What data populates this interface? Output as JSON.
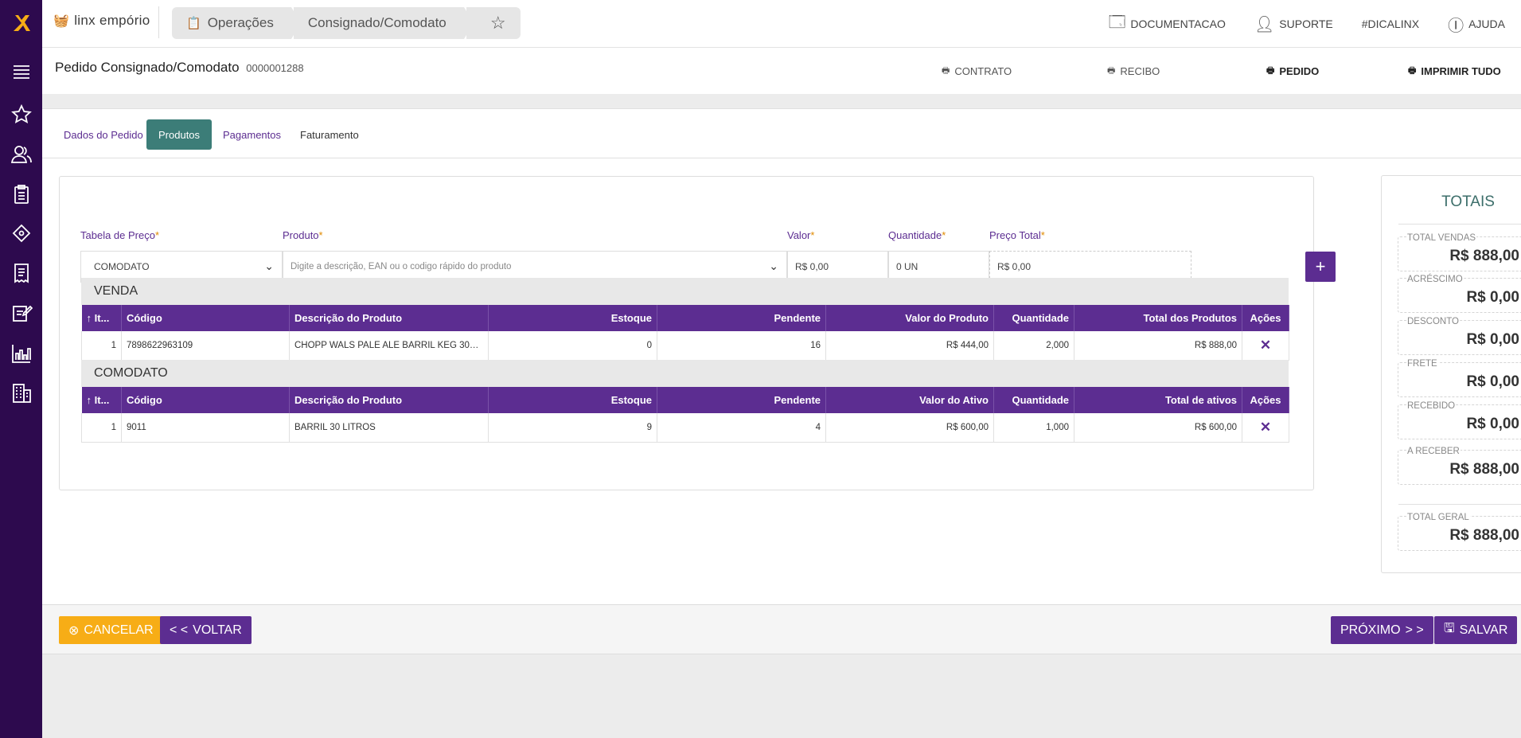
{
  "app": {
    "brand": "linx empório"
  },
  "breadcrumb": {
    "items": [
      "Operações",
      "Consignado/Comodato"
    ]
  },
  "top_links": [
    "DOCUMENTACAO",
    "SUPORTE",
    "#DICALINX",
    "AJUDA"
  ],
  "page": {
    "title": "Pedido Consignado/Comodato",
    "number": "0000001288"
  },
  "print_links": {
    "contrato": "CONTRATO",
    "recibo": "RECIBO",
    "pedido": "PEDIDO",
    "imprimir_tudo": "IMPRIMIR TUDO"
  },
  "tabs": [
    "Dados do Pedido",
    "Produtos",
    "Pagamentos",
    "Faturamento"
  ],
  "form": {
    "tabela_label": "Tabela de Preço",
    "tabela_value": "COMODATO",
    "produto_label": "Produto",
    "produto_placeholder": "Digite a descrição, EAN ou o codigo rápido do produto",
    "valor_label": "Valor",
    "valor_value": "R$ 0,00",
    "quantidade_label": "Quantidade",
    "quantidade_value": "0 UN",
    "preco_total_label": "Preço Total",
    "preco_total_value": "R$ 0,00",
    "required_mark": "*",
    "add_button": "+"
  },
  "venda": {
    "title": "VENDA",
    "headers": [
      "It...",
      "Código",
      "Descrição do Produto",
      "Estoque",
      "Pendente",
      "Valor do Produto",
      "Quantidade",
      "Total dos Produtos",
      "Ações"
    ],
    "rows": [
      {
        "item": "1",
        "codigo": "7898622963109",
        "descricao": "CHOPP WALS PALE ALE BARRIL KEG 30L ...",
        "estoque": "0",
        "pendente": "16",
        "valor": "R$ 444,00",
        "quantidade": "2,000",
        "total": "R$ 888,00"
      }
    ]
  },
  "comodato": {
    "title": "COMODATO",
    "headers": [
      "It...",
      "Código",
      "Descrição do Produto",
      "Estoque",
      "Pendente",
      "Valor do Ativo",
      "Quantidade",
      "Total de ativos",
      "Ações"
    ],
    "rows": [
      {
        "item": "1",
        "codigo": "9011",
        "descricao": "BARRIL 30 LITROS",
        "estoque": "9",
        "pendente": "4",
        "valor": "R$ 600,00",
        "quantidade": "1,000",
        "total": "R$ 600,00"
      }
    ]
  },
  "totais": {
    "title": "TOTAIS",
    "items": [
      {
        "label": "TOTAL VENDAS",
        "value": "R$ 888,00"
      },
      {
        "label": "ACRÉSCIMO",
        "value": "R$ 0,00"
      },
      {
        "label": "DESCONTO",
        "value": "R$ 0,00"
      },
      {
        "label": "FRETE",
        "value": "R$ 0,00"
      },
      {
        "label": "RECEBIDO",
        "value": "R$ 0,00"
      },
      {
        "label": "A RECEBER",
        "value": "R$ 888,00"
      }
    ],
    "geral": {
      "label": "TOTAL GERAL",
      "value": "R$ 888,00"
    }
  },
  "buttons": {
    "cancelar": "CANCELAR",
    "voltar": "VOLTAR",
    "proximo": "PRÓXIMO",
    "salvar": "SALVAR"
  },
  "colors": {
    "primary": "#5c2d91",
    "sidebar": "#2d0a4e",
    "tab_active": "#3c7d78",
    "cancel": "#f7ad16",
    "required": "#e08a00"
  }
}
